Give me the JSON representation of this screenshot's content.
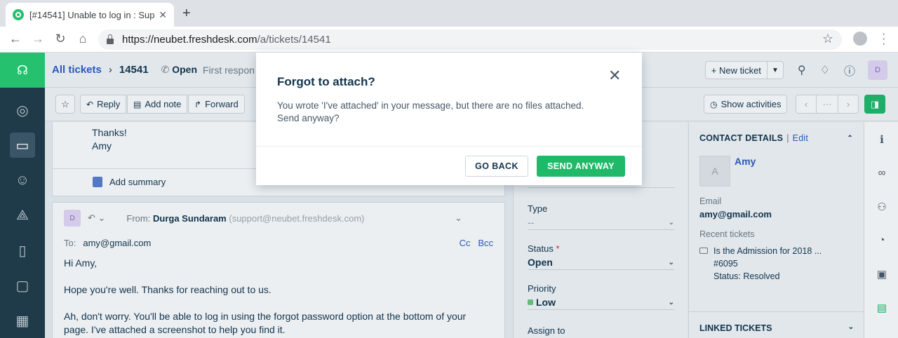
{
  "browser": {
    "tab_title": "[#14541] Unable to log in : Sup",
    "tab_close": "✕",
    "new_tab": "+",
    "url_host": "https://neubet.freshdesk.com",
    "url_path": "/a/tickets/14541"
  },
  "header": {
    "breadcrumb_link": "All tickets",
    "ticket_id": "14541",
    "status": "Open",
    "sub": "First respon",
    "new_ticket_label": "+ New ticket",
    "avatar": "D"
  },
  "toolbar": {
    "reply": "Reply",
    "add_note": "Add note",
    "forward": "Forward",
    "show_activities": "Show activities",
    "pager_more": "···"
  },
  "conversation": {
    "closing_line1": "Thanks!",
    "closing_line2": "Amy",
    "add_summary": "Add summary",
    "reply": {
      "avatar": "D",
      "from_label": "From:",
      "from_name": "Durga Sundaram",
      "from_email": "(support@neubet.freshdesk.com)",
      "to_label": "To:",
      "to_value": "amy@gmail.com",
      "cc": "Cc",
      "bcc": "Bcc",
      "line1": "Hi Amy,",
      "line2": "Hope you're well. Thanks for reaching out to us.",
      "line3": "Ah, don't worry. You'll be able to log in using the forgot password option at the bottom of your page. I've attached a screenshot to help you find it."
    }
  },
  "properties": {
    "type_label": "Type",
    "type_value": "--",
    "status_label": "Status",
    "status_required": "*",
    "status_value": "Open",
    "priority_label": "Priority",
    "priority_value": "Low",
    "priority_color": "#6ac77e",
    "assign_label": "Assign to"
  },
  "contact": {
    "heading": "CONTACT DETAILS",
    "edit": "Edit",
    "avatar": "A",
    "name": "Amy",
    "email_label": "Email",
    "email_value": "amy@gmail.com",
    "recent_label": "Recent tickets",
    "recent_title": "Is the Admission for 2018 ...",
    "recent_id": "#6095",
    "recent_status": "Status: Resolved",
    "linked_heading": "LINKED TICKETS"
  },
  "modal": {
    "title": "Forgot to attach?",
    "body_line1": "You wrote 'I've attached' in your message, but there are no files attached.",
    "body_line2": "Send anyway?",
    "go_back": "GO BACK",
    "send_anyway": "SEND ANYWAY",
    "accent": "#20b96a"
  }
}
